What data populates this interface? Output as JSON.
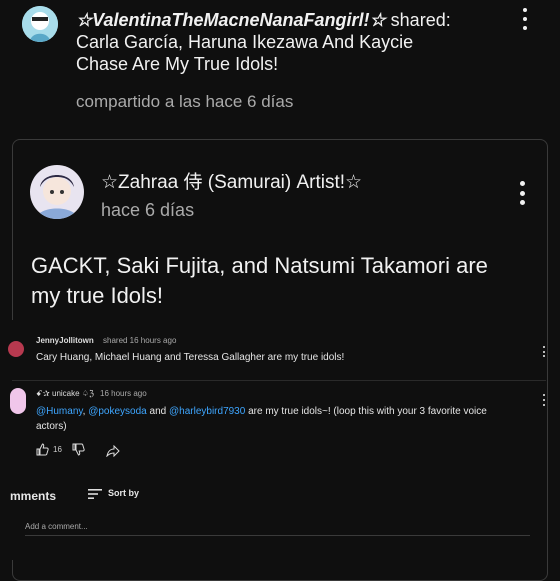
{
  "share_header": {
    "author": "☆ValentinaTheMacneNanaFangirl!☆",
    "shared_word": " shared:",
    "title_line1": "Carla García, Haruna Ikezawa And Kaycie",
    "title_line2": "Chase Are My True Idols!",
    "shared_time": "compartido a las hace 6 días"
  },
  "post": {
    "author": "☆Zahraa 侍 (Samurai) Artist!☆",
    "time": "hace 6 días",
    "text_line1": "GACKT, Saki Fujita, and Natsumi Takamori are",
    "text_line2": "my true Idols!"
  },
  "shared_preview": {
    "author": "JennyJollitown",
    "meta": "shared 16 hours ago",
    "text": "Cary Huang, Michael Huang and Teressa Gallagher are my true idols!"
  },
  "inner_comment": {
    "author": "ꗃ✰ unicake ♤ℨ",
    "time": "16 hours ago",
    "mention1": "@Humany",
    "sep1": ", ",
    "mention2": "@pokeysoda",
    "sep2": " and ",
    "mention3": "@harleybird7930",
    "rest1": " are my true idols~! (loop this with your 3 favorite voice",
    "rest2": "actors)",
    "like_count": "16"
  },
  "comments_bar": {
    "title": "mments",
    "sort_label": "Sort by",
    "add_placeholder": "Add a comment..."
  },
  "icons": [
    "menu-dots-icon",
    "thumbs-up-icon",
    "thumbs-down-icon",
    "share-icon",
    "sort-icon"
  ],
  "colors": {
    "background": "#0f0f0f",
    "text": "#f1f1f1",
    "secondary": "#aaaaaa",
    "link": "#3ea6ff",
    "card_border": "#3a3a3a"
  }
}
